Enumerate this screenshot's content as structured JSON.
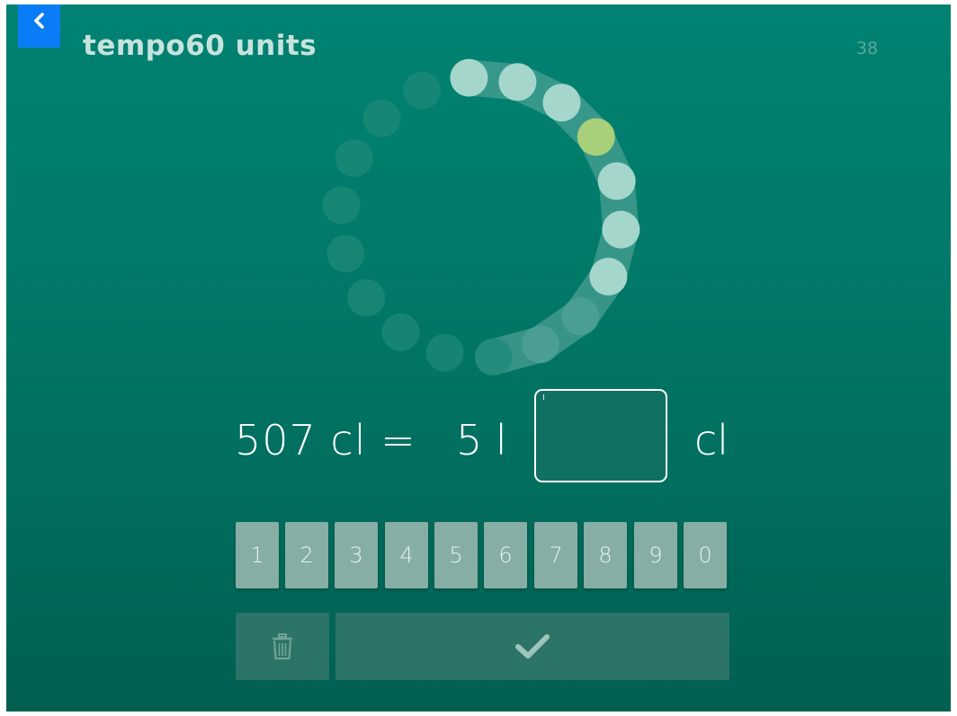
{
  "header": {
    "title": "tempo60 units",
    "counter": "38",
    "back_icon": "chevron-left-icon"
  },
  "progress": {
    "total_steps": 18,
    "completed": 7,
    "current_step": 3,
    "colors": {
      "track": "#5ba89c",
      "done_dot": "#a5d6cc",
      "current_dot": "#a8cf7a",
      "pending_dot": "#1e8a78"
    }
  },
  "question": {
    "left": "507 cl =",
    "value": "5 l",
    "unit": "cl",
    "answer": ""
  },
  "keypad": {
    "keys": [
      "1",
      "2",
      "3",
      "4",
      "5",
      "6",
      "7",
      "8",
      "9",
      "0"
    ],
    "delete_icon": "trash-icon",
    "confirm_icon": "check-icon"
  },
  "theme": {
    "background": "#018272",
    "back_button": "#0a7cf6",
    "key_color": "#86aea5"
  }
}
